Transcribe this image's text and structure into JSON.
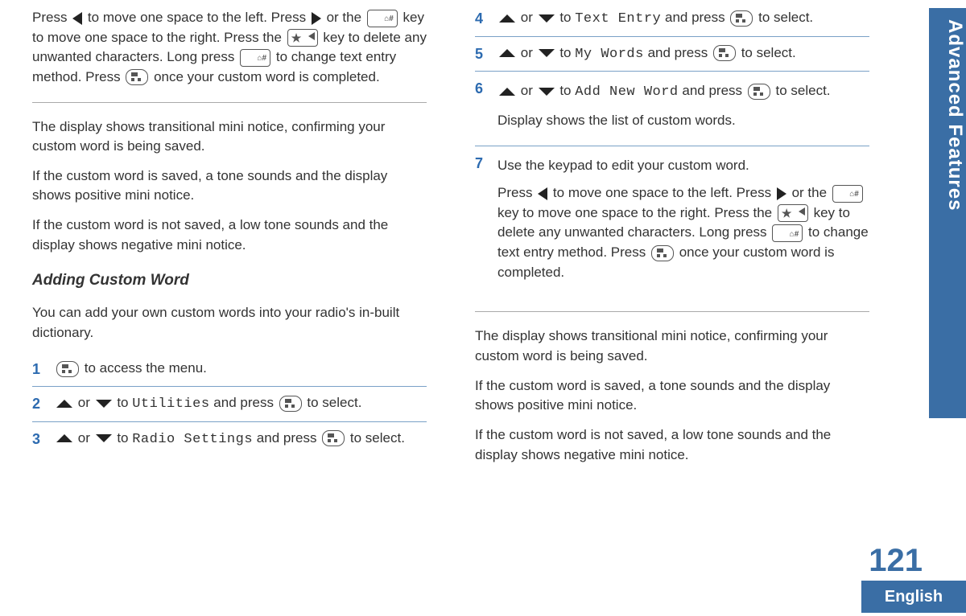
{
  "sidebar": {
    "section_title": "Advanced Features"
  },
  "footer": {
    "page_number": "121",
    "language": "English"
  },
  "col1": {
    "intro_p1a": "Press ",
    "intro_p1b": " to move one space to the left. Press ",
    "intro_p1c": " or the ",
    "intro_p1d": " key to move one space to the right. Press the ",
    "intro_p1e": " key to delete any unwanted characters. Long press ",
    "intro_p1f": " to change text entry method. Press ",
    "intro_p1g": " once your custom word is completed.",
    "p2": "The display shows transitional mini notice, confirming your custom word is being saved.",
    "p3": "If the custom word is saved, a tone sounds and the display shows positive mini notice.",
    "p4": "If the custom word is not saved, a low tone sounds and the display shows negative mini notice.",
    "heading": "Adding Custom Word",
    "desc": "You can add your own custom words into your radio's in-built dictionary.",
    "step1_suffix": " to access the menu.",
    "or": " or ",
    "to": " to ",
    "and_press": " and press ",
    "to_select": " to select.",
    "menu_utilities": "Utilities",
    "menu_radio_settings": "Radio Settings"
  },
  "col2": {
    "or": " or ",
    "to": " to ",
    "and_press": " and press ",
    "to_select": " to select.",
    "menu_text_entry": "Text Entry",
    "menu_my_words": "My Words",
    "menu_add_new_word": "Add New Word",
    "step6_extra": "Display shows the list of custom words.",
    "step7_line1": "Use the keypad to edit your custom word.",
    "s7a": "Press ",
    "s7b": " to move one space to the left. Press ",
    "s7c": " or the ",
    "s7d": " key to move one space to the right. Press the ",
    "s7e": " key to delete any unwanted characters. Long press ",
    "s7f": " to change text entry method. Press ",
    "s7g": " once your custom word is completed.",
    "p2": "The display shows transitional mini notice, confirming your custom word is being saved.",
    "p3": "If the custom word is saved, a tone sounds and the display shows positive mini notice.",
    "p4": "If the custom word is not saved, a low tone sounds and the display shows negative mini notice."
  },
  "step_numbers": {
    "s1": "1",
    "s2": "2",
    "s3": "3",
    "s4": "4",
    "s5": "5",
    "s6": "6",
    "s7": "7"
  }
}
